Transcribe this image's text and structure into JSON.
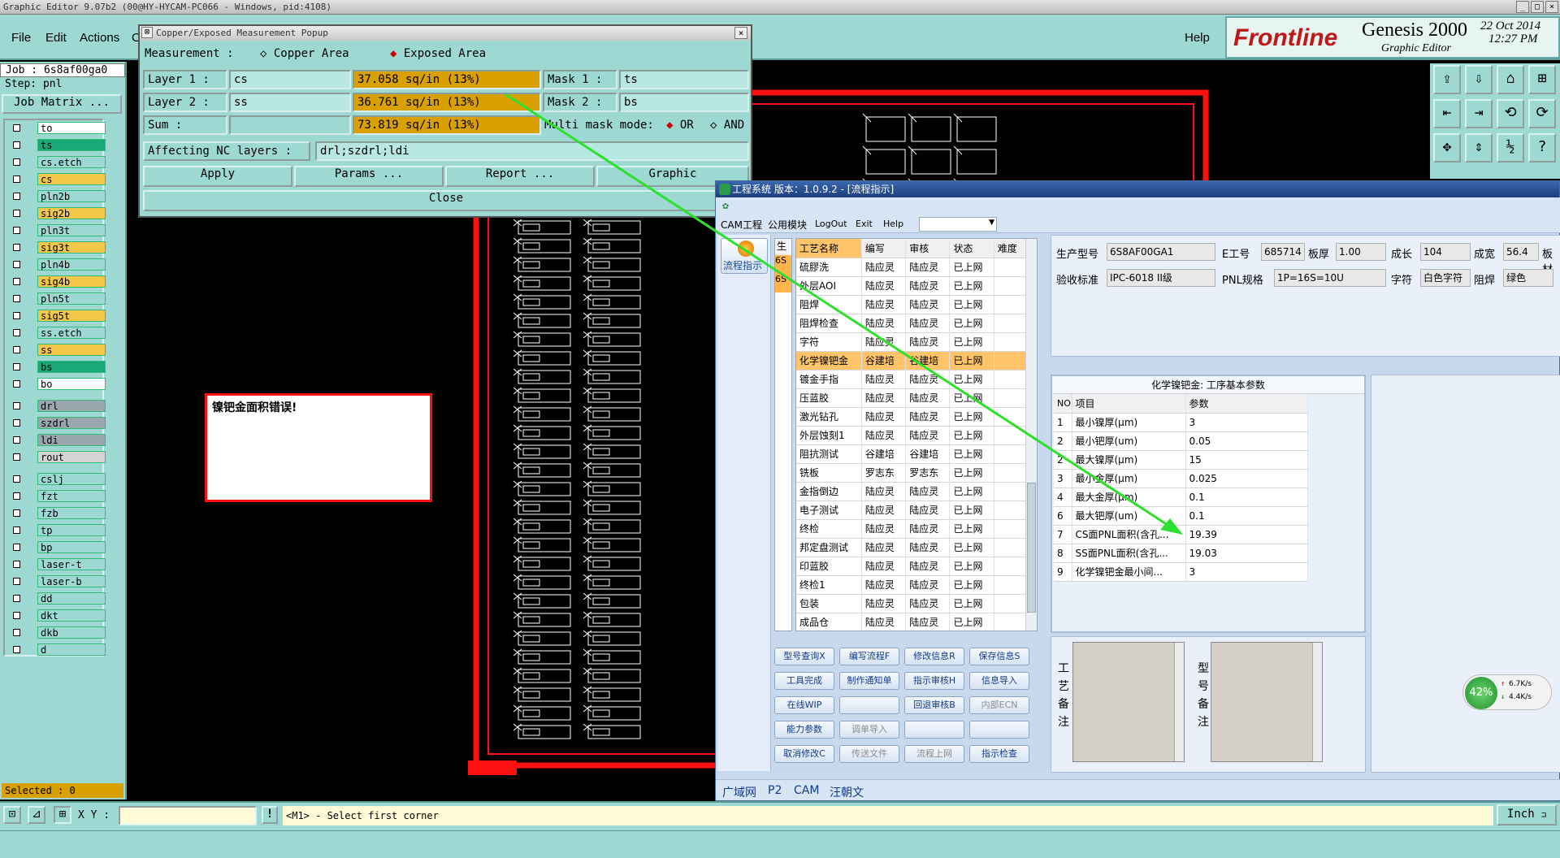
{
  "titlebar": {
    "text": "Graphic Editor 9.07b2 (00@HY-HYCAM-PC066 - Windows, pid:4108)"
  },
  "menubar": {
    "items": [
      "File",
      "Edit",
      "Actions",
      "O"
    ],
    "help": "Help"
  },
  "logo": {
    "brand": "Frontline",
    "product": "Genesis 2000",
    "subtitle": "Graphic Editor",
    "date": "22 Oct 2014",
    "time": "12:27 PM"
  },
  "left_panel": {
    "job": "Job : 6s8af00ga0",
    "step": "Step: pnl",
    "job_matrix": "Job Matrix ...",
    "selected": "Selected : 0",
    "layers": [
      {
        "name": "to",
        "color": "#ffffff"
      },
      {
        "name": "ts",
        "color": "#1aa878"
      },
      {
        "name": "cs.etch",
        "color": "#9ed8d2"
      },
      {
        "name": "cs",
        "color": "#f3c84a"
      },
      {
        "name": "pln2b",
        "color": "#9ed8d2"
      },
      {
        "name": "sig2b",
        "color": "#f3c84a"
      },
      {
        "name": "pln3t",
        "color": "#9ed8d2"
      },
      {
        "name": "sig3t",
        "color": "#f3c84a"
      },
      {
        "name": "pln4b",
        "color": "#9ed8d2"
      },
      {
        "name": "sig4b",
        "color": "#f3c84a"
      },
      {
        "name": "pln5t",
        "color": "#9ed8d2"
      },
      {
        "name": "sig5t",
        "color": "#f3c84a"
      },
      {
        "name": "ss.etch",
        "color": "#9ed8d2"
      },
      {
        "name": "ss",
        "color": "#f3c84a"
      },
      {
        "name": "bs",
        "color": "#1aa878"
      },
      {
        "name": "bo",
        "color": "#ffffff"
      },
      {
        "name": "drl",
        "color": "#9aa6ad"
      },
      {
        "name": "szdrl",
        "color": "#9aa6ad"
      },
      {
        "name": "ldi",
        "color": "#9aa6ad"
      },
      {
        "name": "rout",
        "color": "#d4d4d4"
      },
      {
        "name": "cslj",
        "color": "#9ed8d2"
      },
      {
        "name": "fzt",
        "color": "#9ed8d2"
      },
      {
        "name": "fzb",
        "color": "#9ed8d2"
      },
      {
        "name": "tp",
        "color": "#9ed8d2"
      },
      {
        "name": "bp",
        "color": "#9ed8d2"
      },
      {
        "name": "laser-t",
        "color": "#9ed8d2"
      },
      {
        "name": "laser-b",
        "color": "#9ed8d2"
      },
      {
        "name": "dd",
        "color": "#9ed8d2"
      },
      {
        "name": "dkt",
        "color": "#9ed8d2"
      },
      {
        "name": "dkb",
        "color": "#9ed8d2"
      },
      {
        "name": "d",
        "color": "#9ed8d2"
      }
    ]
  },
  "popup": {
    "title": "Copper/Exposed Measurement Popup",
    "measurement_label": "Measurement   :",
    "copper_area": "Copper Area",
    "exposed_area": "Exposed Area",
    "layer1_label": "Layer 1 :",
    "layer1_value": "cs",
    "layer1_area": "37.058 sq/in (13%)",
    "mask1_label": "Mask 1 :",
    "mask1_value": "ts",
    "layer2_label": "Layer 2 :",
    "layer2_value": "ss",
    "layer2_area": "36.761 sq/in (13%)",
    "mask2_label": "Mask 2 :",
    "mask2_value": "bs",
    "sum_label": "Sum     :",
    "sum_area": "73.819 sq/in (13%)",
    "multi_mask_label": "Multi mask mode:",
    "or_label": "OR",
    "and_label": "AND",
    "affecting_label": "Affecting NC layers :",
    "affecting_value": "drl;szdrl;ldi",
    "apply": "Apply",
    "params": "Params ...",
    "report": "Report ...",
    "graphic": "Graphic",
    "close": "Close"
  },
  "error_box": {
    "text": "镍钯金面积错误!"
  },
  "cam": {
    "title": "工程系统     版本：1.0.9.2 - [流程指示]",
    "menu": [
      "CAM工程",
      "公用模块",
      "LogOut",
      "Exit",
      "Help"
    ],
    "side_button": "流程指示",
    "narrow_col": [
      "生",
      "6S",
      "6S"
    ],
    "columns": [
      "工艺名称",
      "编写",
      "审核",
      "状态",
      "难度"
    ],
    "rows": [
      [
        "硫膠洗",
        "陆应灵",
        "陆应灵",
        "已上网"
      ],
      [
        "外层AOI",
        "陆应灵",
        "陆应灵",
        "已上网"
      ],
      [
        "阻焊",
        "陆应灵",
        "陆应灵",
        "已上网"
      ],
      [
        "阻焊检查",
        "陆应灵",
        "陆应灵",
        "已上网"
      ],
      [
        "字符",
        "陆应灵",
        "陆应灵",
        "已上网"
      ],
      [
        "化学镍钯金",
        "谷建培",
        "谷建培",
        "已上网"
      ],
      [
        "镀金手指",
        "陆应灵",
        "陆应灵",
        "已上网"
      ],
      [
        "压蓝胶",
        "陆应灵",
        "陆应灵",
        "已上网"
      ],
      [
        "激光钻孔",
        "陆应灵",
        "陆应灵",
        "已上网"
      ],
      [
        "外层蚀刻1",
        "陆应灵",
        "陆应灵",
        "已上网"
      ],
      [
        "阻抗测试",
        "谷建培",
        "谷建培",
        "已上网"
      ],
      [
        "铣板",
        "罗志东",
        "罗志东",
        "已上网"
      ],
      [
        "金指倒边",
        "陆应灵",
        "陆应灵",
        "已上网"
      ],
      [
        "电子测试",
        "陆应灵",
        "陆应灵",
        "已上网"
      ],
      [
        "终检",
        "陆应灵",
        "陆应灵",
        "已上网"
      ],
      [
        "邦定盘测试",
        "陆应灵",
        "陆应灵",
        "已上网"
      ],
      [
        "印蓝胶",
        "陆应灵",
        "陆应灵",
        "已上网"
      ],
      [
        "终检1",
        "陆应灵",
        "陆应灵",
        "已上网"
      ],
      [
        "包装",
        "陆应灵",
        "陆应灵",
        "已上网"
      ],
      [
        "成品仓",
        "陆应灵",
        "陆应灵",
        "已上网"
      ]
    ],
    "buttons": [
      [
        "型号查询X",
        "编写流程F",
        "修改信息R",
        "保存信息S"
      ],
      [
        "工具完成",
        "制作通知单",
        "指示审核H",
        "信息导入"
      ],
      [
        "在线WIP",
        "",
        "回退审核B",
        "内部ECN"
      ],
      [
        "能力参数",
        "调单导入",
        "",
        ""
      ],
      [
        "取消修改C",
        "传送文件",
        "流程上网",
        "指示检查"
      ]
    ],
    "info": {
      "model_label": "生产型号",
      "model": "6S8AF00GA1",
      "ework_label": "E工号",
      "ework": "685714",
      "thick_label": "板厚",
      "thick": "1.00",
      "len_label": "成长",
      "len": "104",
      "width_label": "成宽",
      "width": "56.4",
      "mat_label": "板材",
      "std_label": "验收标准",
      "std": "IPC-6018 II级",
      "pnl_label": "PNL规格",
      "pnl": "1P=16S=10U",
      "char_label": "字符",
      "char": "白色字符",
      "mask_label": "阻焊",
      "mask": "绿色"
    },
    "params_title": "化学镍钯金: 工序基本参数",
    "params_cols": [
      "NO",
      "项目",
      "参数"
    ],
    "params": [
      [
        "1",
        "最小镍厚(μm)",
        "3"
      ],
      [
        "2",
        "最小钯厚(um)",
        "0.05"
      ],
      [
        "2",
        "最大镍厚(μm)",
        "15"
      ],
      [
        "3",
        "最小金厚(μm)",
        "0.025"
      ],
      [
        "4",
        "最大金厚(μm)",
        "0.1"
      ],
      [
        "6",
        "最大钯厚(um)",
        "0.1"
      ],
      [
        "7",
        "CS面PNL面积(含孔...",
        "19.39"
      ],
      [
        "8",
        "SS面PNL面积(含孔...",
        "19.03"
      ],
      [
        "9",
        "化学镍钯金最小间...",
        "3"
      ]
    ],
    "note1": "工艺备注",
    "note2": "型号备注",
    "tabs": [
      "广域网",
      "P2",
      "CAM",
      "汪朝文"
    ],
    "net_percent": "42%",
    "net_up": "6.7K/s",
    "net_down": "4.4K/s"
  },
  "statusbar": {
    "xy_label": "X Y :",
    "message": "<M1> - Select first corner",
    "unit": "Inch"
  }
}
